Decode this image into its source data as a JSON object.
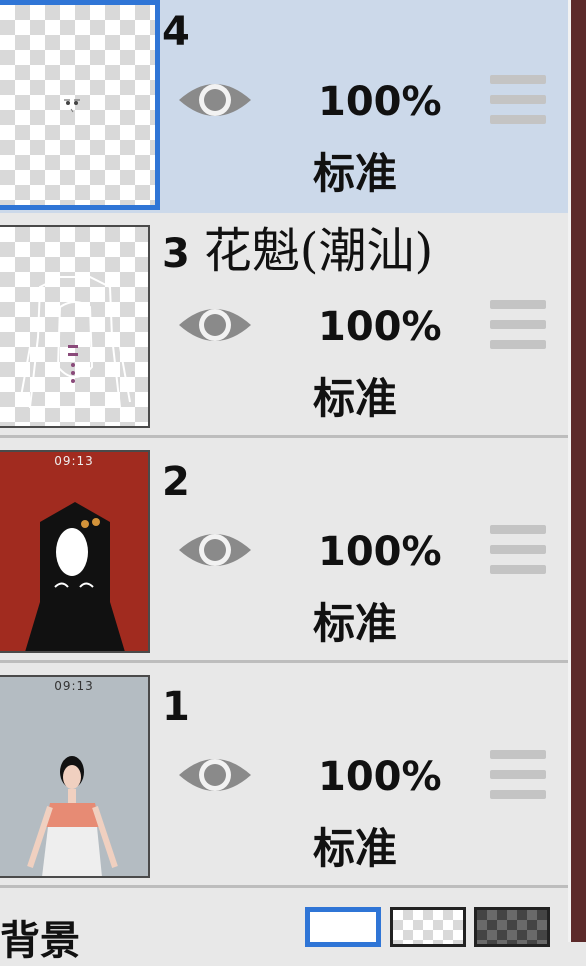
{
  "layers": [
    {
      "number": "4",
      "name": "",
      "opacity": "100%",
      "blend_mode": "标准",
      "selected": true
    },
    {
      "number": "3",
      "name": "花魁(潮汕)",
      "opacity": "100%",
      "blend_mode": "标准",
      "selected": false
    },
    {
      "number": "2",
      "name": "",
      "opacity": "100%",
      "blend_mode": "标准",
      "selected": false,
      "thumbnail_time": "09:13"
    },
    {
      "number": "1",
      "name": "",
      "opacity": "100%",
      "blend_mode": "标准",
      "selected": false,
      "thumbnail_time": "09:13"
    }
  ],
  "background": {
    "label": "背景"
  },
  "colors": {
    "accent": "#2f75d6",
    "selected_row": "#ccd9ea",
    "row": "#e8e8e8",
    "eye": "#8a8a8a",
    "layer2_bg": "#a12b1f",
    "scroll_bar": "#5c2a2a"
  },
  "icons": {
    "visibility": "eye-icon",
    "reorder": "drag-handle-icon"
  }
}
